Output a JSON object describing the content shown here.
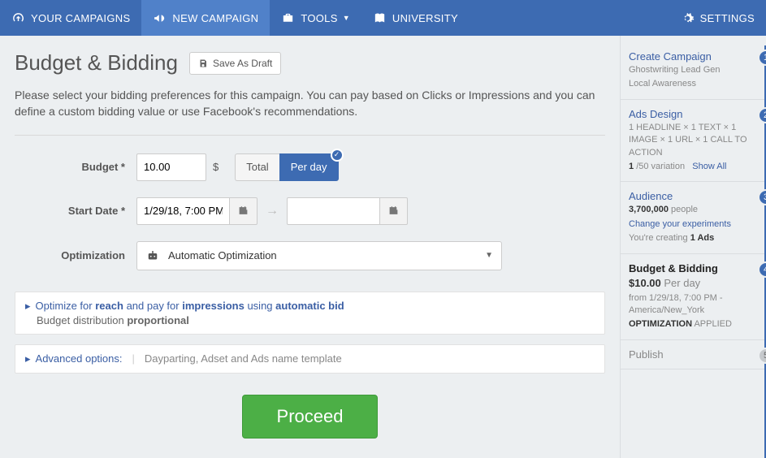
{
  "nav": {
    "campaigns": "YOUR CAMPAIGNS",
    "new": "NEW CAMPAIGN",
    "tools": "TOOLS",
    "university": "UNIVERSITY",
    "settings": "SETTINGS"
  },
  "page": {
    "title": "Budget & Bidding",
    "save_draft": "Save As Draft",
    "intro": "Please select your bidding preferences for this campaign. You can pay based on Clicks or Impressions and you can define a custom bidding value or use Facebook's recommendations."
  },
  "form": {
    "budget_label": "Budget *",
    "budget_value": "10.00",
    "budget_currency": "$",
    "toggle_total": "Total",
    "toggle_perday": "Per day",
    "start_label": "Start Date *",
    "start_value": "1/29/18, 7:00 PM",
    "end_value": "",
    "optimization_label": "Optimization",
    "optimization_value": "Automatic Optimization"
  },
  "info1": {
    "pre": "Optimize for",
    "reach": "reach",
    "mid1": "and pay for",
    "impressions": "impressions",
    "mid2": "using",
    "auto": "automatic bid",
    "line2_pre": "Budget distribution",
    "line2_b": "proportional"
  },
  "info2": {
    "label": "Advanced options:",
    "desc": "Dayparting, Adset and Ads name template"
  },
  "proceed": "Proceed",
  "steps": {
    "s1": {
      "title": "Create Campaign",
      "line1": "Ghostwriting Lead Gen",
      "line2": "Local Awareness"
    },
    "s2": {
      "title": "Ads Design",
      "line1": "1 HEADLINE × 1 TEXT × 1 IMAGE × 1 URL × 1 CALL TO ACTION",
      "var_val": "1",
      "var_sep": "/50 variation",
      "showall": "Show All"
    },
    "s3": {
      "title": "Audience",
      "people_n": "3,700,000",
      "people_t": " people",
      "action": "Change your experiments",
      "creating_pre": "You're creating ",
      "creating_b": "1 Ads"
    },
    "s4": {
      "title": "Budget & Bidding",
      "price": "$10.00",
      "unit": " Per day",
      "from": "from 1/29/18, 7:00 PM - America/New_York",
      "opt_l": "OPTIMIZATION",
      "opt_v": " APPLIED"
    },
    "s5": {
      "title": "Publish"
    }
  }
}
